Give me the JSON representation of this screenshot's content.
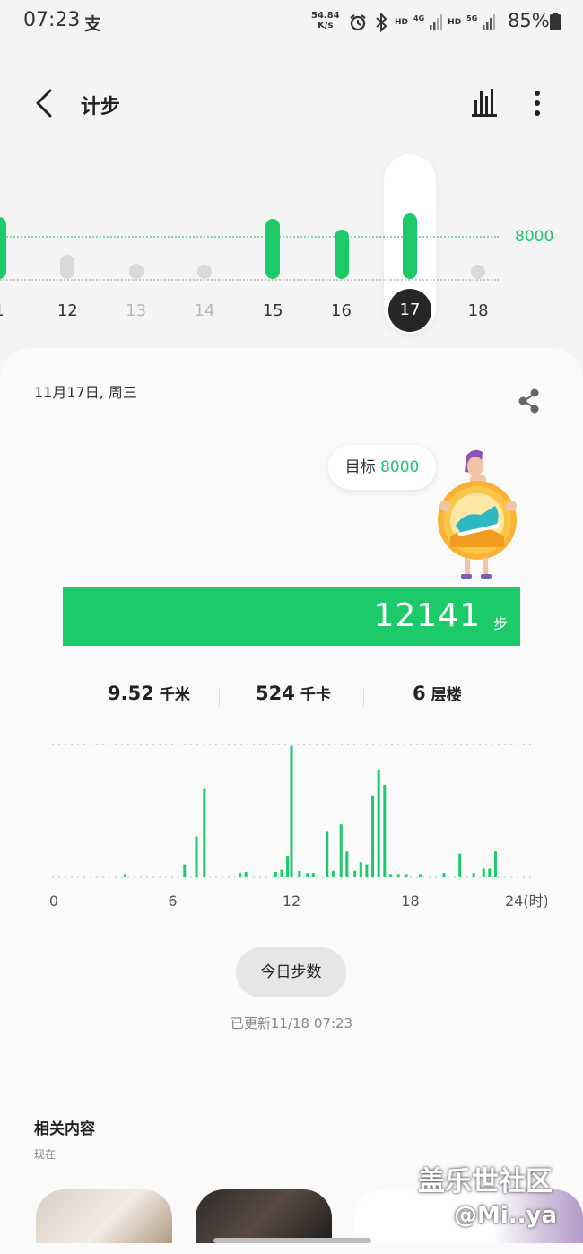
{
  "status_bar": {
    "time": "07:23",
    "pay_icon": "支",
    "speed_value": "54.84",
    "speed_unit": "K/s",
    "hd1": "HD",
    "net1": "4G",
    "hd2": "HD",
    "net2": "5G",
    "battery": "85%"
  },
  "header": {
    "title": "计步",
    "back_icon": "chevron-left-icon",
    "stats_icon": "bar-chart-icon",
    "more_icon": "more-vertical-icon"
  },
  "week_chart": {
    "goal_label": "8000",
    "goal": 8000,
    "selected_day": "17",
    "days": [
      {
        "label": "1",
        "steps": 11500,
        "met": true
      },
      {
        "label": "12",
        "steps": 4500,
        "met": false
      },
      {
        "label": "13",
        "steps": 2900,
        "met": false
      },
      {
        "label": "14",
        "steps": 1900,
        "met": false
      },
      {
        "label": "15",
        "steps": 11200,
        "met": true
      },
      {
        "label": "16",
        "steps": 9200,
        "met": true
      },
      {
        "label": "17",
        "steps": 12141,
        "met": true
      },
      {
        "label": "18",
        "steps": 300,
        "met": false
      }
    ]
  },
  "card": {
    "date": "11月17日, 周三",
    "share_icon": "share-icon",
    "goal_text": "目标",
    "goal_value": "8000",
    "steps": "12141",
    "steps_unit": "步",
    "distance": "9.52",
    "distance_unit": "千米",
    "calories": "524",
    "calories_unit": "千卡",
    "floors": "6",
    "floors_unit": "层楼",
    "today_button": "今日步数",
    "updated": "已更新11/18 07:23"
  },
  "chart_data": {
    "type": "bar",
    "xlabel": "",
    "ylabel": "",
    "x_ticks": [
      "0",
      "6",
      "12",
      "18",
      "24(时)"
    ],
    "xlim": [
      0,
      24
    ],
    "x": [
      3.6,
      6.6,
      7.2,
      7.6,
      9.4,
      9.7,
      11.2,
      11.5,
      11.8,
      12.0,
      12.4,
      12.8,
      13.1,
      13.8,
      14.1,
      14.5,
      14.8,
      15.2,
      15.5,
      15.8,
      16.1,
      16.4,
      16.7,
      17.0,
      17.4,
      17.8,
      18.5,
      19.7,
      20.5,
      21.2,
      21.7,
      22.0,
      22.3
    ],
    "values": [
      0.03,
      0.12,
      0.38,
      0.82,
      0.04,
      0.05,
      0.05,
      0.07,
      0.2,
      1.22,
      0.06,
      0.04,
      0.04,
      0.43,
      0.06,
      0.49,
      0.24,
      0.06,
      0.14,
      0.12,
      0.76,
      1.0,
      0.86,
      0.03,
      0.03,
      0.03,
      0.03,
      0.04,
      0.22,
      0.04,
      0.08,
      0.08,
      0.24
    ]
  },
  "related": {
    "title": "相关内容",
    "subtitle": "现在"
  },
  "watermark": {
    "line1": "盖乐世社区",
    "line2": "@Mi..ya"
  }
}
